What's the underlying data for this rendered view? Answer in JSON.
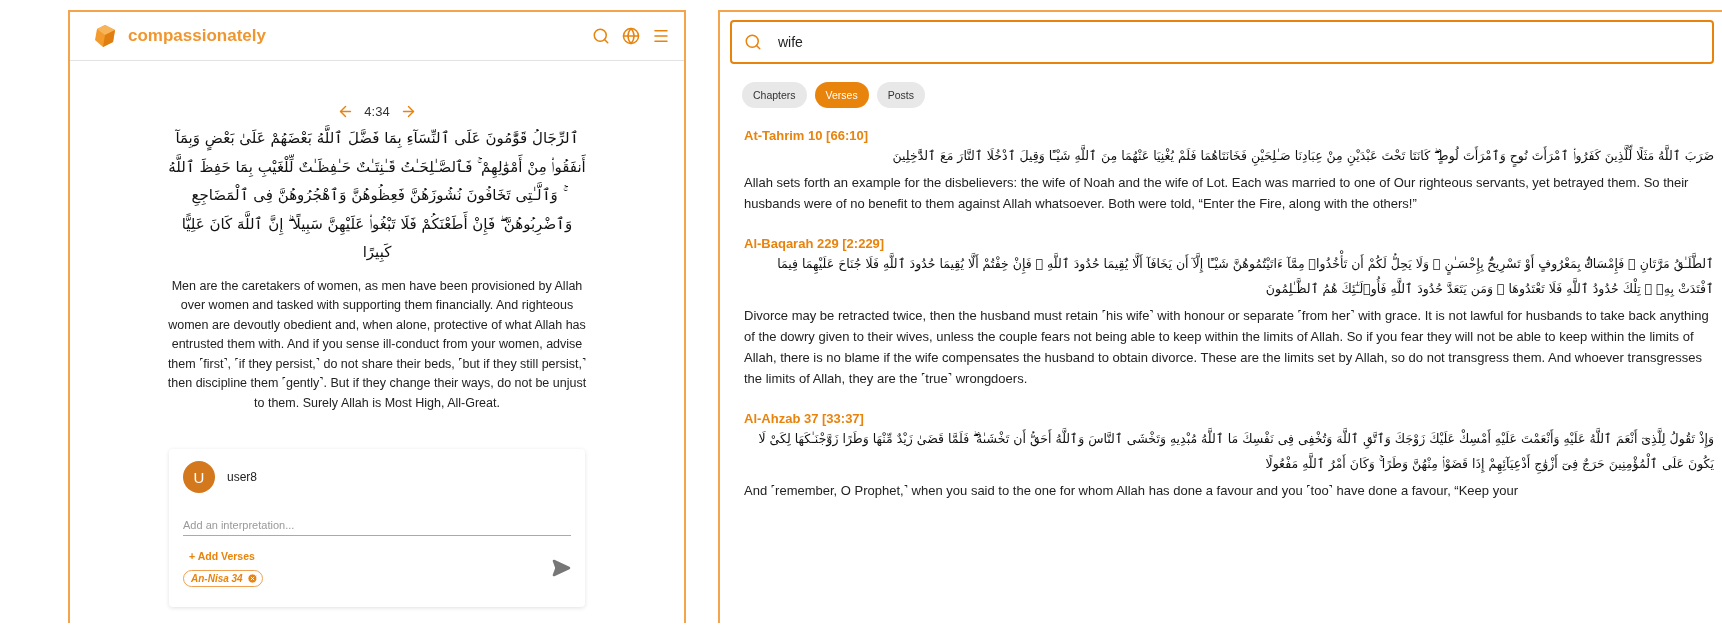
{
  "header": {
    "brand": "compassionately"
  },
  "verse": {
    "reference": "4:34",
    "arabic": "ٱلرِّجَالُ قَوَّٰمُونَ عَلَى ٱلنِّسَآءِ بِمَا فَضَّلَ ٱللَّهُ بَعْضَهُمْ عَلَىٰ بَعْضٍ وَبِمَآ أَنفَقُوا۟ مِنْ أَمْوَٰلِهِمْ ۚ فَٱلصَّـٰلِحَـٰتُ قَـٰنِتَـٰتٌ حَـٰفِظَـٰتٌ لِّلْغَيْبِ بِمَا حَفِظَ ٱللَّهُ ۚ وَٱلَّـٰتِى تَخَافُونَ نُشُوزَهُنَّ فَعِظُوهُنَّ وَٱهْجُرُوهُنَّ فِى ٱلْمَضَاجِعِ وَٱضْرِبُوهُنَّ ۖ فَإِنْ أَطَعْنَكُمْ فَلَا تَبْغُوا۟ عَلَيْهِنَّ سَبِيلًا ۗ إِنَّ ٱللَّهَ كَانَ عَلِيًّا كَبِيرًا",
    "translation": "Men are the caretakers of women, as men have been provisioned by Allah over women and tasked with supporting them financially. And righteous women are devoutly obedient and, when alone, protective of what Allah has entrusted them with. And if you sense ill-conduct from your women, advise them ˹first˺, ˹if they persist,˺ do not share their beds, ˹but if they still persist,˺ then discipline them ˹gently˺. But if they change their ways, do not be unjust to them. Surely Allah is Most High, All-Great."
  },
  "comment_card": {
    "avatar_letter": "U",
    "username": "user8",
    "placeholder": "Add an interpretation...",
    "add_verses": "+ Add Verses",
    "tags": [
      "An-Nisa 34"
    ]
  },
  "search": {
    "value": "wife"
  },
  "filters": [
    {
      "label": "Chapters",
      "selected": false
    },
    {
      "label": "Verses",
      "selected": true
    },
    {
      "label": "Posts",
      "selected": false
    }
  ],
  "results": [
    {
      "title": "At-Tahrim 10 [66:10]",
      "arabic": "ضَرَبَ ٱللَّهُ مَثَلًا لِّلَّذِينَ كَفَرُوا۟ ٱمْرَأَتَ نُوحٍ وَٱمْرَأَتَ لُوطٍ ۖ كَانَتَا تَحْتَ عَبْدَيْنِ مِنْ عِبَادِنَا صَـٰلِحَيْنِ فَخَانَتَاهُمَا فَلَمْ يُغْنِيَا عَنْهُمَا مِنَ ٱللَّهِ شَيْـًٔا وَقِيلَ ٱدْخُلَا ٱلنَّارَ مَعَ ٱلدَّٰخِلِينَ",
      "translation": "Allah sets forth an example for the disbelievers: the wife of Noah and the wife of Lot. Each was married to one of Our righteous servants, yet betrayed them. So their husbands were of no benefit to them against Allah whatsoever. Both were told, “Enter the Fire, along with the others!”"
    },
    {
      "title": "Al-Baqarah 229 [2:229]",
      "arabic": "ٱلطَّلَـٰقُ مَرَّتَانِ ۖ فَإِمْسَاكٌۢ بِمَعْرُوفٍ أَوْ تَسْرِيحٌۢ بِإِحْسَـٰنٍ ۗ وَلَا يَحِلُّ لَكُمْ أَن تَأْخُذُوا۟ مِمَّآ ءَاتَيْتُمُوهُنَّ شَيْـًٔا إِلَّآ أَن يَخَافَآ أَلَّا يُقِيمَا حُدُودَ ٱللَّهِ ۖ فَإِنْ خِفْتُمْ أَلَّا يُقِيمَا حُدُودَ ٱللَّهِ فَلَا جُنَاحَ عَلَيْهِمَا فِيمَا ٱفْتَدَتْ بِهِۦ ۗ تِلْكَ حُدُودُ ٱللَّهِ فَلَا تَعْتَدُوهَا ۚ وَمَن يَتَعَدَّ حُدُودَ ٱللَّهِ فَأُو۟لَـٰٓئِكَ هُمُ ٱلظَّـٰلِمُونَ",
      "translation": "Divorce may be retracted twice, then the husband must retain ˹his wife˺ with honour or separate ˹from her˺ with grace. It is not lawful for husbands to take back anything of the dowry given to their wives, unless the couple fears not being able to keep within the limits of Allah. So if you fear they will not be able to keep within the limits of Allah, there is no blame if the wife compensates the husband to obtain divorce. These are the limits set by Allah, so do not transgress them. And whoever transgresses the limits of Allah, they are the ˹true˺ wrongdoers."
    },
    {
      "title": "Al-Ahzab 37 [33:37]",
      "arabic": "وَإِذْ تَقُولُ لِلَّذِىٓ أَنْعَمَ ٱللَّهُ عَلَيْهِ وَأَنْعَمْتَ عَلَيْهِ أَمْسِكْ عَلَيْكَ زَوْجَكَ وَٱتَّقِ ٱللَّهَ وَتُخْفِى فِى نَفْسِكَ مَا ٱللَّهُ مُبْدِيهِ وَتَخْشَى ٱلنَّاسَ وَٱللَّهُ أَحَقُّ أَن تَخْشَىٰهُ ۖ فَلَمَّا قَضَىٰ زَيْدٌ مِّنْهَا وَطَرًا زَوَّجْنَـٰكَهَا لِكَىْ لَا يَكُونَ عَلَى ٱلْمُؤْمِنِينَ حَرَجٌ فِىٓ أَزْوَٰجِ أَدْعِيَآئِهِمْ إِذَا قَضَوْا۟ مِنْهُنَّ وَطَرًا ۚ وَكَانَ أَمْرُ ٱللَّهِ مَفْعُولًا",
      "translation": "And ˹remember, O  Prophet,˺ when you said to the one for whom Allah has done a favour and you ˹too˺ have done a favour, “Keep your"
    }
  ]
}
